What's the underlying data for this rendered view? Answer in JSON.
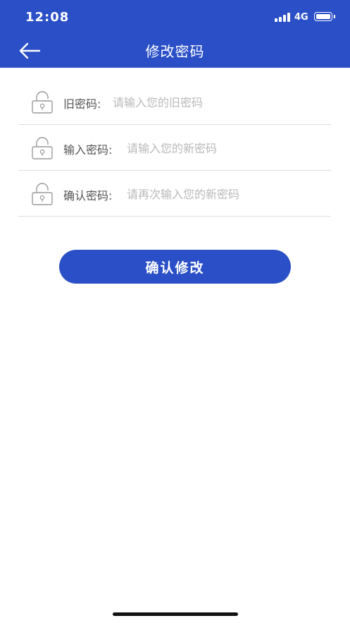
{
  "status_bar": {
    "time": "12:08",
    "network": "4G"
  },
  "header": {
    "title": "修改密码",
    "back_icon": "arrow-left-icon",
    "background": "#2a4fc7"
  },
  "form": {
    "fields": [
      {
        "label": "旧密码:",
        "placeholder": "请输入您的旧密码",
        "value": "",
        "icon": "lock-icon"
      },
      {
        "label": "输入密码:",
        "placeholder": "请输入您的新密码",
        "value": "",
        "icon": "lock-icon"
      },
      {
        "label": "确认密码:",
        "placeholder": "请再次输入您的新密码",
        "value": "",
        "icon": "lock-icon"
      }
    ]
  },
  "confirm_button": {
    "label": "确认修改",
    "color": "#2a4fc7"
  }
}
